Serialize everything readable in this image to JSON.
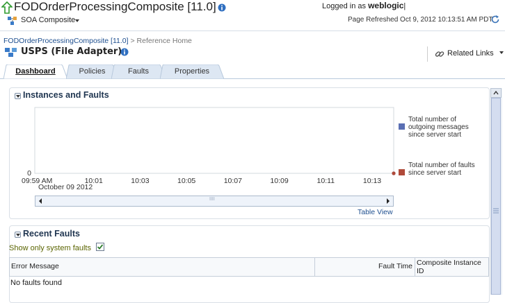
{
  "header": {
    "app_title": "FODOrderProcessingComposite [11.0]",
    "composite_menu_label": "SOA Composite",
    "logged_in_prefix": "Logged in as",
    "username": "weblogic",
    "logged_in_suffix": "|",
    "page_refreshed": "Page Refreshed Oct 9, 2012 10:13:51 AM PDT"
  },
  "breadcrumb": {
    "parent": "FODOrderProcessingComposite [11.0]",
    "separator": ">",
    "current": "Reference Home"
  },
  "page": {
    "title": "USPS (File Adapter)",
    "related_links_label": "Related Links"
  },
  "tabs": [
    {
      "label": "Dashboard",
      "active": true
    },
    {
      "label": "Policies",
      "active": false
    },
    {
      "label": "Faults",
      "active": false
    },
    {
      "label": "Properties",
      "active": false
    }
  ],
  "instances_panel": {
    "title": "Instances and Faults",
    "table_view_link": "Table View",
    "scroll_grip": "IIII"
  },
  "chart_data": {
    "type": "line",
    "title": "",
    "xlabel": "",
    "ylabel": "",
    "date_label": "October 09 2012",
    "x_ticks": [
      "09:59 AM",
      "10:01",
      "10:03",
      "10:05",
      "10:07",
      "10:09",
      "10:11",
      "10:13"
    ],
    "y_ticks": [
      "0"
    ],
    "ylim": [
      0,
      1
    ],
    "series": [
      {
        "name": "Total number of outgoing messages since server start",
        "color": "#5a6fb4",
        "x": [
          "10:13"
        ],
        "values": [
          0
        ]
      },
      {
        "name": "Total number of faults since server start",
        "color": "#b04a3a",
        "x": [
          "10:13"
        ],
        "values": [
          0
        ]
      }
    ],
    "grid": false,
    "legend_position": "right"
  },
  "faults_panel": {
    "title": "Recent Faults",
    "show_only_system_label": "Show only system faults",
    "show_only_system_checked": true,
    "columns": [
      "Error Message",
      "Fault Time",
      "Composite Instance ID"
    ],
    "empty_message": "No faults found"
  }
}
